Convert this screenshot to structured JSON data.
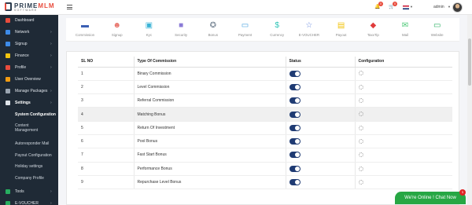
{
  "brand": {
    "name_main": "PRIME",
    "name_accent": "MLM",
    "sub": "SOFTWARE"
  },
  "topbar": {
    "notification_count": "0",
    "cart_count": "0",
    "language_flag": "uk-flag-icon",
    "user_name": "admin",
    "accent_color": "#e84c3d"
  },
  "sidebar": {
    "items": [
      {
        "label": "Dashboard",
        "icon": "dashboard-icon",
        "color": "#e84c3d",
        "has_children": false
      },
      {
        "label": "Network",
        "icon": "network-icon",
        "color": "#3d8be8",
        "has_children": true
      },
      {
        "label": "Signup",
        "icon": "signup-icon",
        "color": "#3d8be8",
        "has_children": true
      },
      {
        "label": "Finance",
        "icon": "finance-icon",
        "color": "#f1c40f",
        "has_children": true
      },
      {
        "label": "Profile",
        "icon": "profile-icon",
        "color": "#e84c3d",
        "has_children": true
      },
      {
        "label": "User Overview",
        "icon": "user-overview-icon",
        "color": "#f39c12",
        "has_children": false
      },
      {
        "label": "Manage Packages",
        "icon": "packages-icon",
        "color": "#9aa5b1",
        "has_children": true
      },
      {
        "label": "Settings",
        "icon": "settings-icon",
        "color": "#dfe4ea",
        "has_children": true
      }
    ],
    "settings_sub": [
      "System Configuration",
      "Content Management",
      "Autoresponder Mail",
      "Payout Configuration",
      "Holiday settings",
      "Company Profile"
    ],
    "bottom_items": [
      {
        "label": "Tools",
        "icon": "tools-icon",
        "color": "#27ae60"
      },
      {
        "label": "E-VOUCHER",
        "icon": "evoucher-icon",
        "color": "#27ae60"
      }
    ]
  },
  "config_strip": [
    {
      "label": "Commission",
      "icon": "commission-icon",
      "color": "#3b5fb3",
      "glyph": "▬"
    },
    {
      "label": "Signup",
      "icon": "signup-user-icon",
      "color": "#e8736a",
      "glyph": "☻"
    },
    {
      "label": "Kyc",
      "icon": "kyc-icon",
      "color": "#3bb3d6",
      "glyph": "▣"
    },
    {
      "label": "Security",
      "icon": "security-lock-icon",
      "color": "#8a7bd6",
      "glyph": "■"
    },
    {
      "label": "Bonus",
      "icon": "bonus-award-icon",
      "color": "#7f8c9a",
      "glyph": "✪"
    },
    {
      "label": "Payment",
      "icon": "payment-card-icon",
      "color": "#4aa3df",
      "glyph": "▭"
    },
    {
      "label": "Currency",
      "icon": "currency-icon",
      "color": "#2ec4b6",
      "glyph": "$"
    },
    {
      "label": "E-VOUCHER",
      "icon": "evoucher-star-icon",
      "color": "#6c8ce0",
      "glyph": "☆"
    },
    {
      "label": "Payout",
      "icon": "payout-icon",
      "color": "#f1c40f",
      "glyph": "▤"
    },
    {
      "label": "TaxxTip",
      "icon": "tax-tag-icon",
      "color": "#e03c3c",
      "glyph": "◆"
    },
    {
      "label": "Mail",
      "icon": "mail-icon",
      "color": "#48c774",
      "glyph": "✉"
    },
    {
      "label": "Website",
      "icon": "website-monitor-icon",
      "color": "#27ae60",
      "glyph": "▭"
    }
  ],
  "table": {
    "headers": [
      "SL NO",
      "Type Of Commission",
      "Status",
      "Configuration"
    ],
    "rows": [
      {
        "sl": "1",
        "type": "Binary Commission"
      },
      {
        "sl": "2",
        "type": "Level Commission"
      },
      {
        "sl": "3",
        "type": "Referral Commission"
      },
      {
        "sl": "4",
        "type": "Matching Bonus"
      },
      {
        "sl": "5",
        "type": "Return Of Investment"
      },
      {
        "sl": "6",
        "type": "Pool Bonus"
      },
      {
        "sl": "7",
        "type": "Fast Start Bonus"
      },
      {
        "sl": "8",
        "type": "Performance Bonus"
      },
      {
        "sl": "9",
        "type": "Repurchase Level Bonus"
      }
    ],
    "toggle_color": "#1f3b73"
  },
  "chat": {
    "label": "We're Online ! Chat Now",
    "badge": "1",
    "color": "#27a744"
  }
}
